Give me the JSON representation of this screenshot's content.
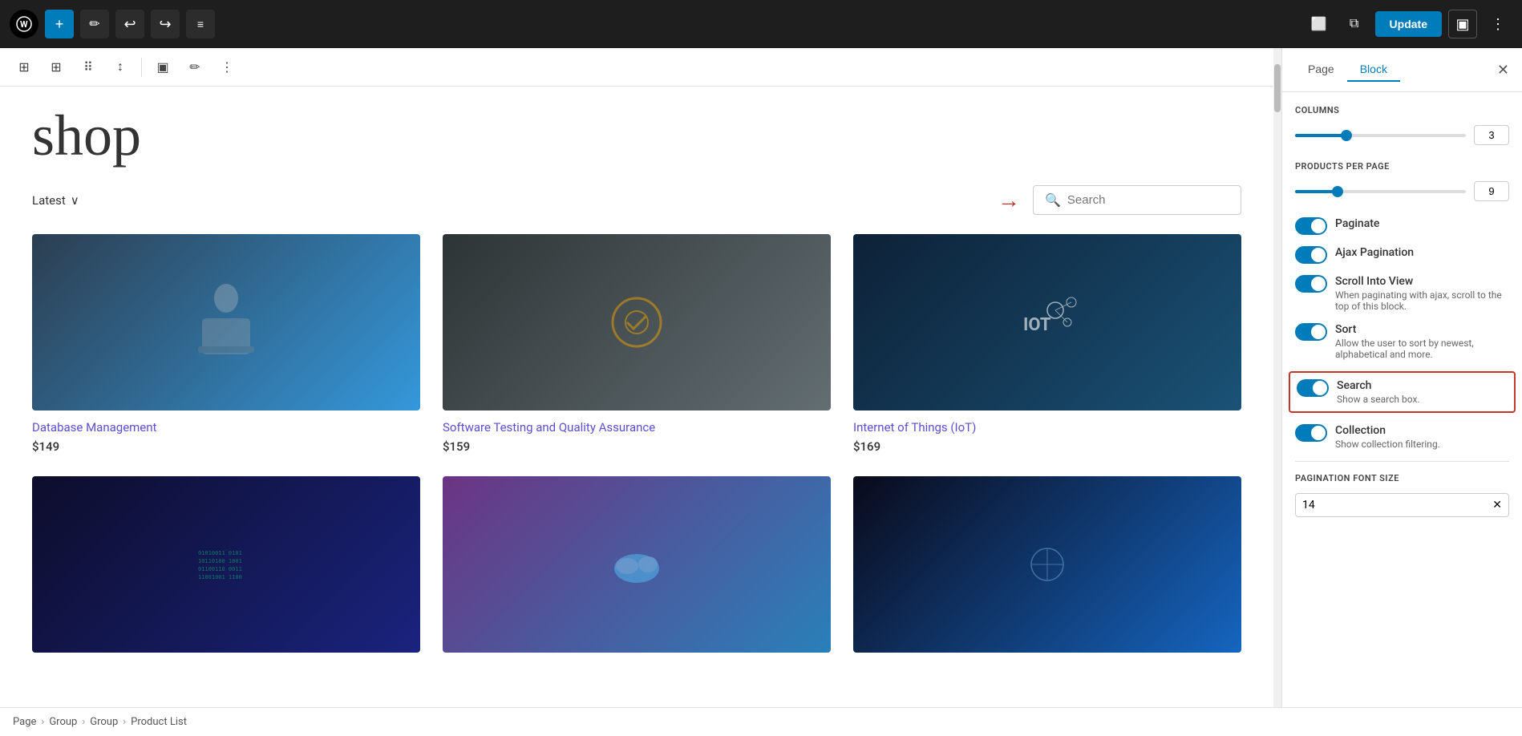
{
  "toolbar": {
    "wp_logo": "W",
    "add_label": "+",
    "brush_label": "✏",
    "undo_label": "↩",
    "redo_label": "↪",
    "menu_label": "≡",
    "update_label": "Update",
    "view_icon": "⬜",
    "external_icon": "⧉",
    "settings_icon": "▣",
    "more_icon": "⋮"
  },
  "block_toolbar": {
    "tools": [
      "⊞",
      "⊟",
      "⠿",
      "↕",
      "▣",
      "✏",
      "⋮"
    ]
  },
  "shop": {
    "title": "shop",
    "sort_label": "Latest",
    "sort_arrow": "∨",
    "search_placeholder": "Search"
  },
  "products": [
    {
      "name": "Database Management",
      "price": "$149",
      "img_class": "img-db"
    },
    {
      "name": "Software Testing and Quality Assurance",
      "price": "$159",
      "img_class": "img-sw"
    },
    {
      "name": "Internet of Things (IoT)",
      "price": "$169",
      "img_class": "img-iot"
    },
    {
      "name": "",
      "price": "",
      "img_class": "img-code"
    },
    {
      "name": "",
      "price": "",
      "img_class": "img-cloud"
    },
    {
      "name": "",
      "price": "",
      "img_class": "img-dark"
    }
  ],
  "panel": {
    "tab_page": "Page",
    "tab_block": "Block",
    "close_icon": "✕",
    "sections": {
      "columns_label": "COLUMNS",
      "columns_value": "3",
      "products_per_page_label": "PRODUCTS PER PAGE",
      "products_per_page_value": "9",
      "toggles": [
        {
          "label": "Paginate",
          "desc": "",
          "on": true
        },
        {
          "label": "Ajax Pagination",
          "desc": "",
          "on": true
        },
        {
          "label": "Scroll Into View",
          "desc": "When paginating with ajax, scroll to the top of this block.",
          "on": true
        },
        {
          "label": "Sort",
          "desc": "Allow the user to sort by newest, alphabetical and more.",
          "on": true
        },
        {
          "label": "Search",
          "desc": "Show a search box.",
          "on": true,
          "highlighted": true
        },
        {
          "label": "Collection",
          "desc": "Show collection filtering.",
          "on": true
        }
      ],
      "pagination_font_size_label": "PAGINATION FONT SIZE",
      "pagination_font_size_value": "14"
    }
  },
  "breadcrumb": {
    "items": [
      "Page",
      "Group",
      "Group",
      "Product List"
    ]
  },
  "arrow_indicator": "→"
}
